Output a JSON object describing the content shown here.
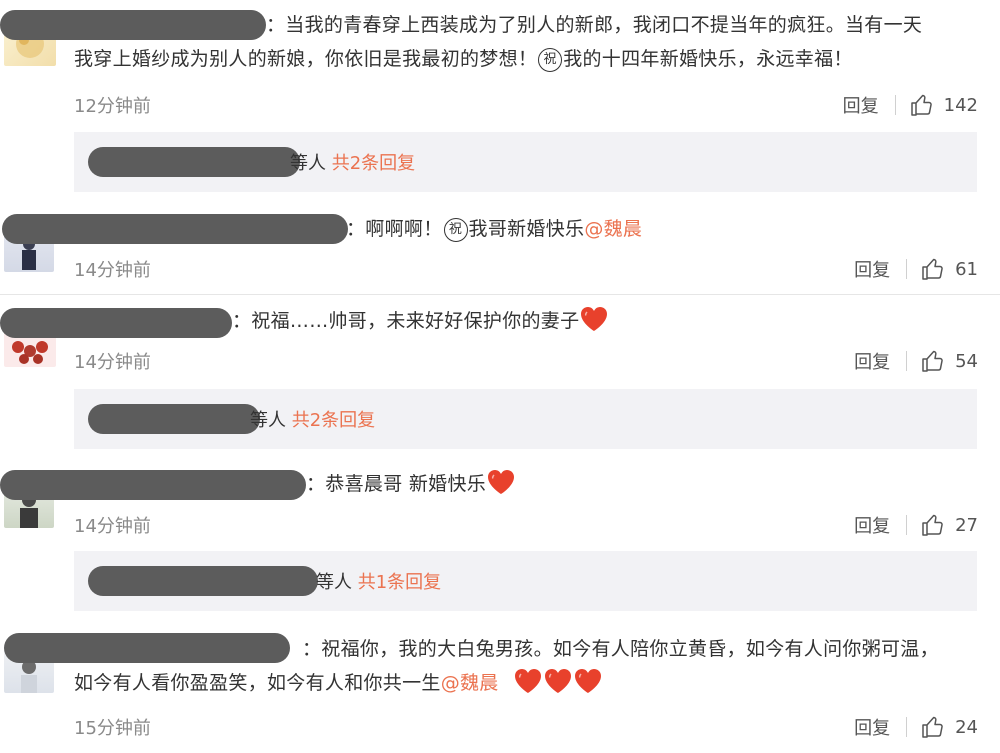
{
  "comments": [
    {
      "text_parts": [
        "：当我的青春穿上西装成为了别人的新郎，我闭口不提当年的疯狂。当有一天",
        "我穿上婚纱成为别人的新娘，你依旧是我最初的梦想！",
        "祝",
        "我的十四年新婚快乐，永远幸福！"
      ],
      "time": "12分钟前",
      "reply_label": "回复",
      "likes": "142",
      "reply_suffix": "等人",
      "reply_count": "共2条回复"
    },
    {
      "text_parts": [
        "：啊啊啊！",
        "祝",
        "我哥新婚快乐",
        "@魏晨"
      ],
      "time": "14分钟前",
      "reply_label": "回复",
      "likes": "61"
    },
    {
      "text_parts": [
        "：祝福……帅哥，未来好好保护你的妻子"
      ],
      "time": "14分钟前",
      "reply_label": "回复",
      "likes": "54",
      "reply_suffix": "等人",
      "reply_count": "共2条回复"
    },
    {
      "text_parts": [
        "：恭喜晨哥 新婚快乐"
      ],
      "time": "14分钟前",
      "reply_label": "回复",
      "likes": "27",
      "reply_suffix": "等人",
      "reply_count": "共1条回复"
    },
    {
      "text_parts": [
        "：祝福你，我的大白兔男孩。如今有人陪你立黄昏，如今有人问你粥可温，",
        "如今有人看你盈盈笑，如今有人和你共一生",
        "@魏晨"
      ],
      "time": "15分钟前",
      "reply_label": "回复",
      "likes": "24"
    }
  ],
  "colors": {
    "mention": "#eb7350",
    "reply_box_bg": "#f2f2f5",
    "heart": "#e8412c",
    "redaction": "#5c5c5c"
  },
  "icons": {
    "like": "thumbs-up-icon",
    "heart": "red-heart-emoji",
    "zhu": "zhu-circle-emoji"
  }
}
